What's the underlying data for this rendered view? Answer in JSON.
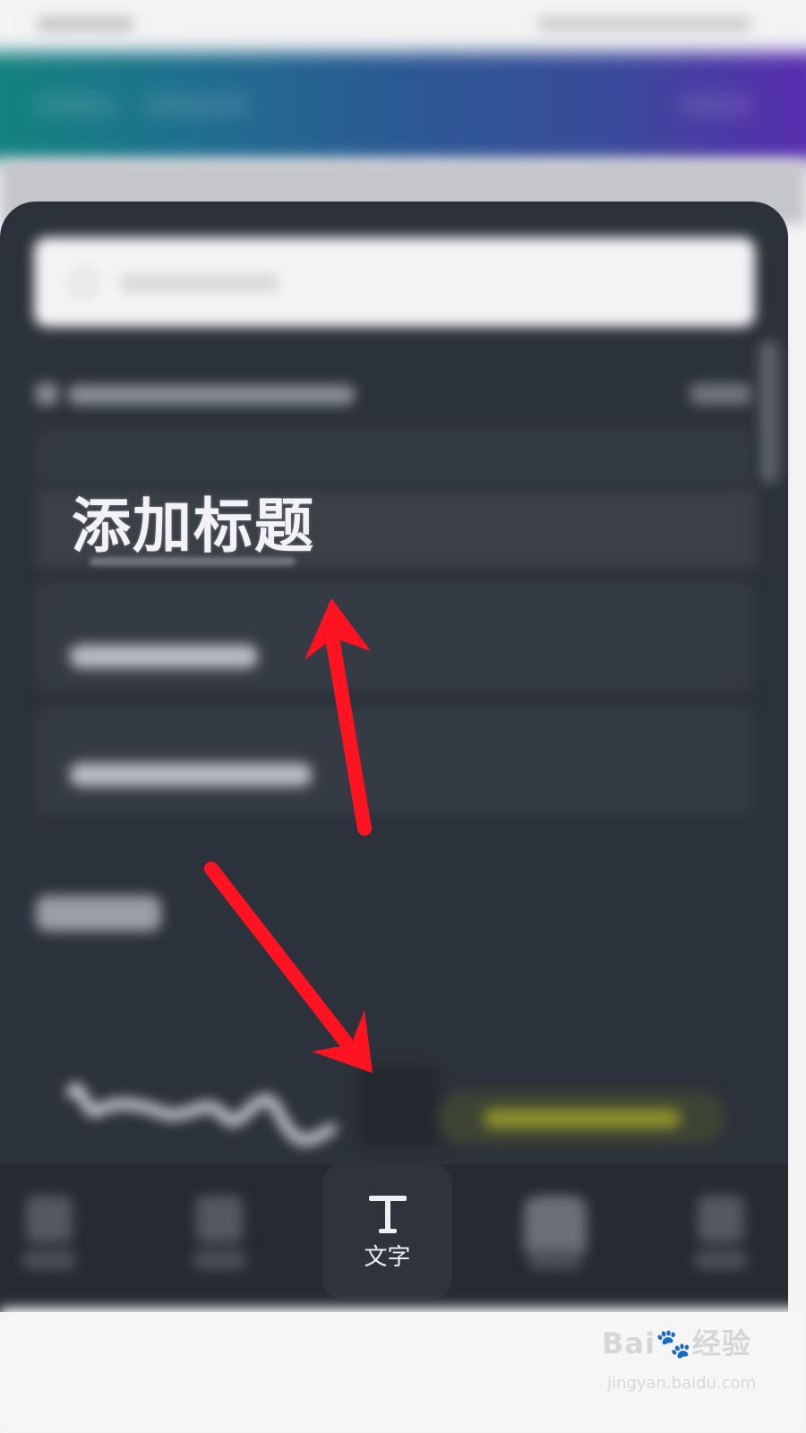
{
  "title_row": {
    "text": "添加标题"
  },
  "bottom_nav": {
    "active_item": {
      "label": "文字",
      "icon": "text-T-icon"
    },
    "other_items": [
      {
        "icon": "blurred-icon"
      },
      {
        "icon": "blurred-icon"
      },
      {
        "icon": "blurred-icon"
      },
      {
        "icon": "blurred-icon"
      }
    ]
  },
  "annotations": {
    "arrow_color": "#ff1320",
    "arrows": [
      {
        "name": "arrow-up-to-title"
      },
      {
        "name": "arrow-down-to-text-tab"
      }
    ]
  },
  "watermark": {
    "logo": "Bai🐾经验",
    "url": "jingyan.baidu.com"
  },
  "colors": {
    "banner_start": "#12847e",
    "banner_end": "#5a2ab0",
    "panel": "#2c323b",
    "accent_yellow": "#8c8f2a"
  }
}
